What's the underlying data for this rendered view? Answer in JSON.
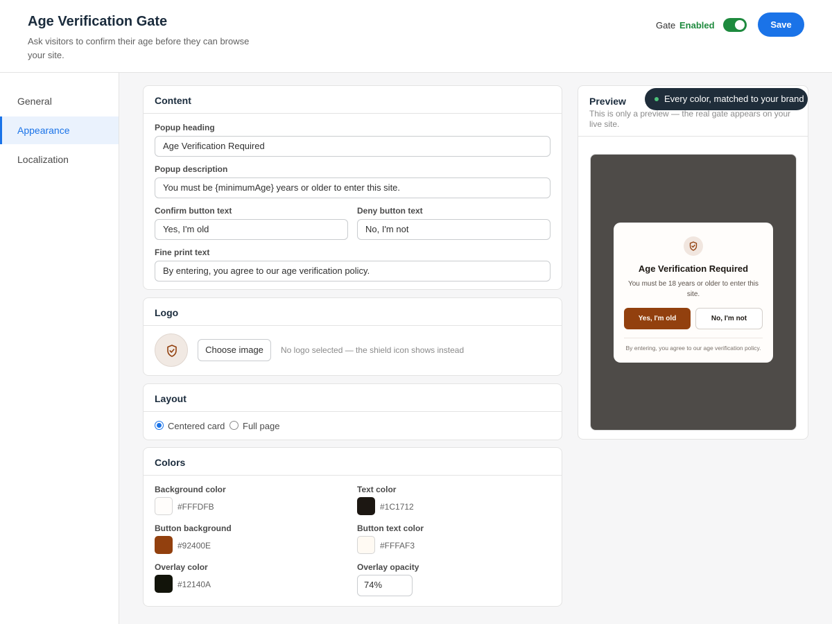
{
  "header": {
    "title": "Age Verification Gate",
    "subtitle": "Ask visitors to confirm their age before they can browse your site.",
    "gate_label": "Gate",
    "gate_status": "Enabled",
    "save_label": "Save"
  },
  "sidebar": {
    "items": [
      {
        "label": "General"
      },
      {
        "label": "Appearance"
      },
      {
        "label": "Localization"
      }
    ]
  },
  "content": {
    "title": "Content",
    "heading_label": "Popup heading",
    "heading_value": "Age Verification Required",
    "description_label": "Popup description",
    "description_value": "You must be {minimumAge} years or older to enter this site.",
    "confirm_label": "Confirm button text",
    "confirm_value": "Yes, I'm old",
    "deny_label": "Deny button text",
    "deny_value": "No, I'm not",
    "fine_label": "Fine print text",
    "fine_value": "By entering, you agree to our age verification policy."
  },
  "logo": {
    "title": "Logo",
    "choose_label": "Choose image",
    "hint": "No logo selected — the shield icon shows instead"
  },
  "layout": {
    "title": "Layout",
    "options": [
      {
        "label": "Centered card",
        "selected": true
      },
      {
        "label": "Full page",
        "selected": false
      }
    ]
  },
  "colors": {
    "title": "Colors",
    "background_label": "Background color",
    "background_value": "#FFFDFB",
    "text_label": "Text color",
    "text_value": "#1C1712",
    "button_bg_label": "Button background",
    "button_bg_value": "#92400E",
    "button_text_label": "Button text color",
    "button_text_value": "#FFFAF3",
    "overlay_label": "Overlay color",
    "overlay_value": "#12140A",
    "opacity_label": "Overlay opacity",
    "opacity_value": "74%"
  },
  "preview": {
    "title": "Preview",
    "description": "This is only a preview — the real gate appears on your live site.",
    "gate_heading": "Age Verification Required",
    "gate_text": "You must be 18 years or older to enter this site.",
    "gate_confirm": "Yes, I'm old",
    "gate_deny": "No, I'm not",
    "gate_fine": "By entering, you agree to our age verification policy."
  },
  "tooltip": {
    "text": "Every color, matched to your brand"
  },
  "colors_accent": {
    "primary": "#1a73e8",
    "enabled": "#1e8a3e"
  }
}
